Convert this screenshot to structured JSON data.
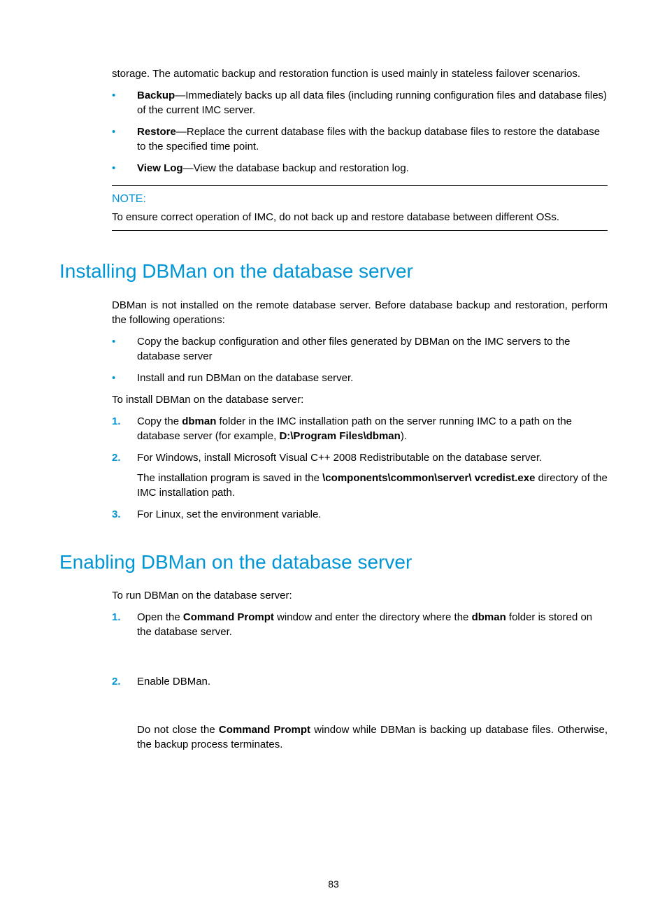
{
  "intro": {
    "storage_para": "storage. The automatic backup and restoration function is used mainly in stateless failover scenarios.",
    "bullets": [
      {
        "term": "Backup",
        "rest": "—Immediately backs up all data files (including running configuration files and database files) of the current IMC server."
      },
      {
        "term": "Restore",
        "rest": "—Replace the current database files with the backup database files to restore the database to the specified time point."
      },
      {
        "term": "View Log",
        "rest": "—View the database backup and restoration log."
      }
    ]
  },
  "note": {
    "label": "NOTE:",
    "text": "To ensure correct operation of IMC, do not back up and restore database between different OSs."
  },
  "section1": {
    "heading": "Installing DBMan on the database server",
    "para1": "DBMan is not installed on the remote database server. Before database backup and restoration, perform the following operations:",
    "bullets": [
      "Copy the backup configuration and other files generated by DBMan on the IMC servers to the database server",
      "Install and run DBMan on the database server."
    ],
    "para2": "To install DBMan on the database server:",
    "step1_a": "Copy the ",
    "step1_b": "dbman",
    "step1_c": " folder in the IMC installation path on the server running IMC to a path on the database server (for example, ",
    "step1_d": "D:\\Program Files\\dbman",
    "step1_e": ").",
    "step2_a": "For Windows, install Microsoft Visual C++ 2008 Redistributable on the database server.",
    "step2_b1": "The installation program is saved in the ",
    "step2_b2": "\\components\\common\\server\\ vcredist.exe ",
    "step2_b3": "directory of the IMC installation path.",
    "step3": "For Linux, set the environment variable."
  },
  "section2": {
    "heading": "Enabling DBMan on the database server",
    "para1": "To run DBMan on the database server:",
    "step1_a": "Open the ",
    "step1_b": "Command Prompt",
    "step1_c": " window and enter the directory where the ",
    "step1_d": "dbman",
    "step1_e": " folder is stored on the database server.",
    "step2": "Enable DBMan.",
    "step2_sub_a": "Do not close the ",
    "step2_sub_b": "Command Prompt",
    "step2_sub_c": " window while DBMan is backing up database files. Otherwise, the backup process terminates."
  },
  "page_number": "83"
}
